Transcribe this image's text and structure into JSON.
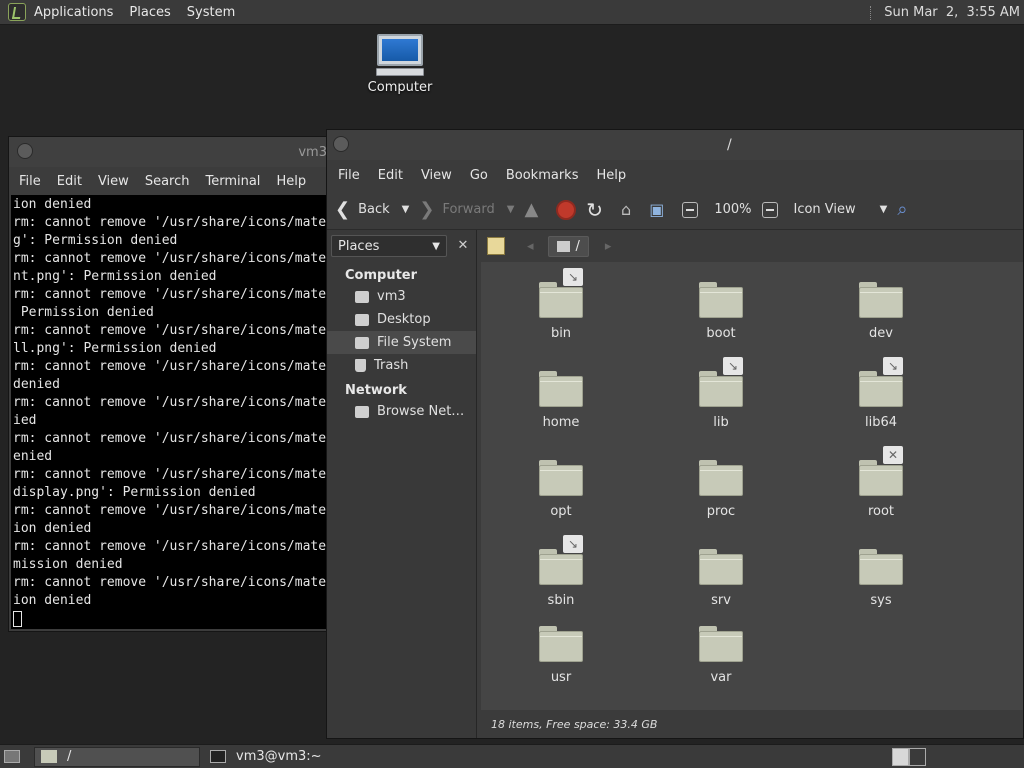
{
  "top_panel": {
    "menus": [
      "Applications",
      "Places",
      "System"
    ],
    "clock": "Sun Mar  2,  3:55 AM"
  },
  "desktop": {
    "icons": [
      {
        "label": "Computer",
        "icon": "computer-icon"
      }
    ]
  },
  "terminal": {
    "title": "vm3",
    "menus": [
      "File",
      "Edit",
      "View",
      "Search",
      "Terminal",
      "Help"
    ],
    "lines": [
      "ion denied",
      "rm: cannot remove '/usr/share/icons/mate",
      "g': Permission denied",
      "rm: cannot remove '/usr/share/icons/mate",
      "nt.png': Permission denied",
      "rm: cannot remove '/usr/share/icons/mate",
      " Permission denied",
      "rm: cannot remove '/usr/share/icons/mate",
      "ll.png': Permission denied",
      "rm: cannot remove '/usr/share/icons/mate",
      "denied",
      "rm: cannot remove '/usr/share/icons/mate",
      "ied",
      "rm: cannot remove '/usr/share/icons/mate",
      "enied",
      "rm: cannot remove '/usr/share/icons/mate",
      "display.png': Permission denied",
      "rm: cannot remove '/usr/share/icons/mate",
      "ion denied",
      "rm: cannot remove '/usr/share/icons/mate",
      "mission denied",
      "rm: cannot remove '/usr/share/icons/mate",
      "ion denied"
    ]
  },
  "file_manager": {
    "title": "/",
    "menus": [
      "File",
      "Edit",
      "View",
      "Go",
      "Bookmarks",
      "Help"
    ],
    "toolbar": {
      "back": "Back",
      "forward": "Forward",
      "zoom": "100%",
      "view_mode": "Icon View"
    },
    "sidebar": {
      "selector": "Places",
      "sections": [
        {
          "heading": "Computer",
          "items": [
            "vm3",
            "Desktop",
            "File System",
            "Trash"
          ]
        },
        {
          "heading": "Network",
          "items": [
            "Browse Net…"
          ]
        }
      ],
      "selected": "File System"
    },
    "path": "/",
    "items": [
      {
        "name": "bin",
        "badge": "↘"
      },
      {
        "name": "boot",
        "badge": ""
      },
      {
        "name": "dev",
        "badge": ""
      },
      {
        "name": "home",
        "badge": ""
      },
      {
        "name": "lib",
        "badge": "↘"
      },
      {
        "name": "lib64",
        "badge": "↘"
      },
      {
        "name": "opt",
        "badge": ""
      },
      {
        "name": "proc",
        "badge": ""
      },
      {
        "name": "root",
        "badge": "✕"
      },
      {
        "name": "sbin",
        "badge": "↘"
      },
      {
        "name": "srv",
        "badge": ""
      },
      {
        "name": "sys",
        "badge": ""
      },
      {
        "name": "usr",
        "badge": ""
      },
      {
        "name": "var",
        "badge": ""
      }
    ],
    "status": "18 items, Free space: 33.4 GB"
  },
  "bottom_panel": {
    "tasks": [
      "/",
      "vm3@vm3:~"
    ]
  },
  "colors": {
    "panel": "#3a3a3a",
    "desktop": "#232323",
    "folder": "#c7cab8"
  }
}
